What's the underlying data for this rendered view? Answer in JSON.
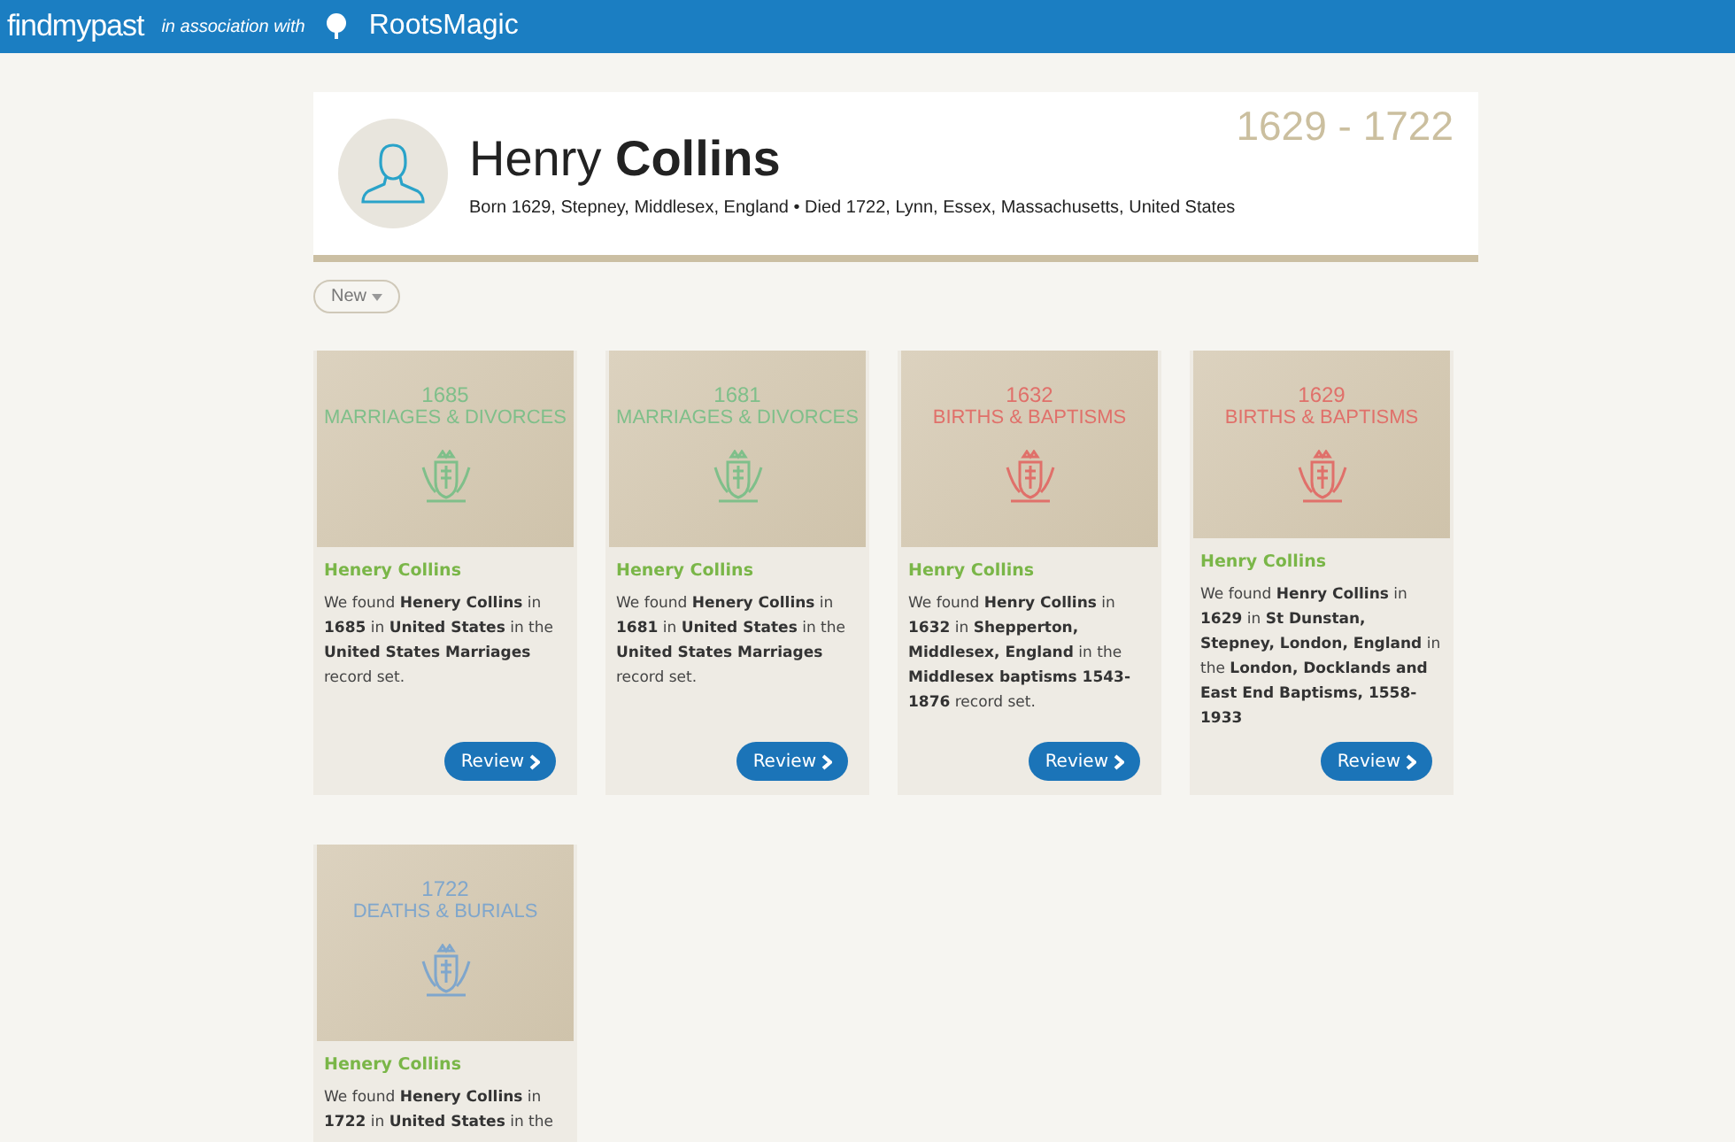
{
  "header": {
    "logo_text": "findmypast",
    "association": "in association with",
    "partner": "RootsMagic"
  },
  "profile": {
    "first_name": "Henry",
    "last_name": "Collins",
    "summary": "Born 1629, Stepney, Middlesex, England • Died 1722, Lynn, Essex, Massachusetts, United States",
    "lifespan": "1629 - 1722"
  },
  "filter_button": {
    "label": "New"
  },
  "records": [
    {
      "year": "1685",
      "category": "MARRIAGES & DIVORCES",
      "color": "#7fbf8a",
      "name": "Henery Collins",
      "description": "We found **Henery Collins** in **1685** in **United States** in the **United States Marriages** record set.",
      "button": "Review"
    },
    {
      "year": "1681",
      "category": "MARRIAGES & DIVORCES",
      "color": "#7fbf8a",
      "name": "Henery Collins",
      "description": "We found **Henery Collins** in **1681** in **United States** in the **United States Marriages** record set.",
      "button": "Review"
    },
    {
      "year": "1632",
      "category": "BIRTHS & BAPTISMS",
      "color": "#e0706a",
      "name": "Henry Collins",
      "description": "We found **Henry Collins** in **1632** in **Shepperton, Middlesex, England** in the **Middlesex baptisms 1543-1876** record set.",
      "button": "Review"
    },
    {
      "year": "1629",
      "category": "BIRTHS & BAPTISMS",
      "color": "#e0706a",
      "name": "Henry Collins",
      "description": "We found **Henry Collins** in **1629** in **St Dunstan, Stepney, London, England** in the **London, Docklands and East End Baptisms, 1558-1933**",
      "button": "Review"
    },
    {
      "year": "1722",
      "category": "DEATHS & BURIALS",
      "color": "#7fa6cc",
      "name": "Henery Collins",
      "description": "We found **Henery Collins** in **1722** in **United States** in the"
    }
  ]
}
